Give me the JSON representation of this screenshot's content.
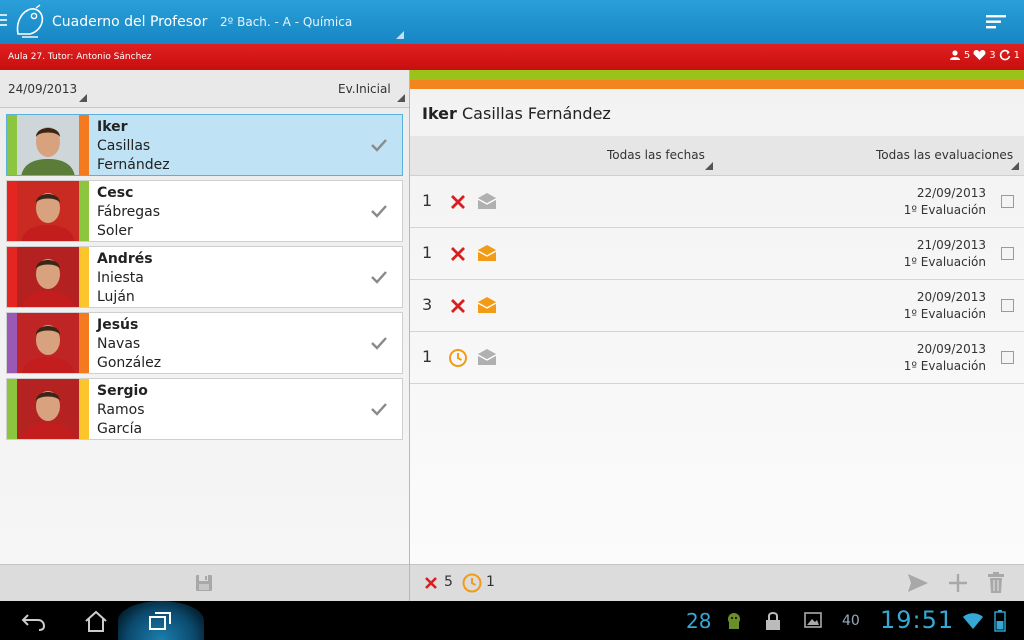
{
  "app": {
    "title": "Cuaderno del Profesor",
    "class_selector": "2º Bach.   - A - Química"
  },
  "info_bar": {
    "tutor": "Aula 27. Tutor: Antonio Sánchez",
    "students_count": "5",
    "hearts_count": "3",
    "refresh_count": "1"
  },
  "left_panel": {
    "date_filter": "24/09/2013",
    "evaluation_filter": "Ev.Inicial",
    "students": [
      {
        "first": "Iker",
        "last1": "Casillas",
        "last2": "Fernández",
        "selected": true,
        "color_left": "#8cc63f",
        "color_right": "#f47a20"
      },
      {
        "first": "Cesc",
        "last1": "Fábregas",
        "last2": "Soler",
        "selected": false,
        "color_left": "#e52520",
        "color_right": "#8cc63f"
      },
      {
        "first": "Andrés",
        "last1": "Iniesta",
        "last2": "Luján",
        "selected": false,
        "color_left": "#e52520",
        "color_right": "#fbc52b"
      },
      {
        "first": "Jesús",
        "last1": "Navas",
        "last2": "González",
        "selected": false,
        "color_left": "#9b59b6",
        "color_right": "#f47a20"
      },
      {
        "first": "Sergio",
        "last1": "Ramos",
        "last2": "García",
        "selected": false,
        "color_left": "#8cc63f",
        "color_right": "#fbc52b"
      }
    ]
  },
  "right_panel": {
    "student_first": "Iker",
    "student_last": "Casillas Fernández",
    "dates_filter": "Todas las fechas",
    "evaluations_filter": "Todas las evaluaciones",
    "records": [
      {
        "count": "1",
        "type": "absence-x",
        "envelope": "gray",
        "date": "22/09/2013",
        "evaluation": "1º Evaluación"
      },
      {
        "count": "1",
        "type": "absence-x",
        "envelope": "orange",
        "date": "21/09/2013",
        "evaluation": "1º Evaluación"
      },
      {
        "count": "3",
        "type": "absence-x",
        "envelope": "orange",
        "date": "20/09/2013",
        "evaluation": "1º Evaluación"
      },
      {
        "count": "1",
        "type": "late-clock",
        "envelope": "gray",
        "date": "20/09/2013",
        "evaluation": "1º Evaluación"
      }
    ],
    "totals": {
      "absences": "5",
      "lates": "1"
    }
  },
  "system_bar": {
    "notification_count": "28",
    "battery": "40",
    "time": "19:51"
  },
  "colors": {
    "accent_blue": "#1a8fcf",
    "red_bar": "#d41616",
    "green_band": "#9bc21a",
    "orange_band": "#f2851e"
  }
}
